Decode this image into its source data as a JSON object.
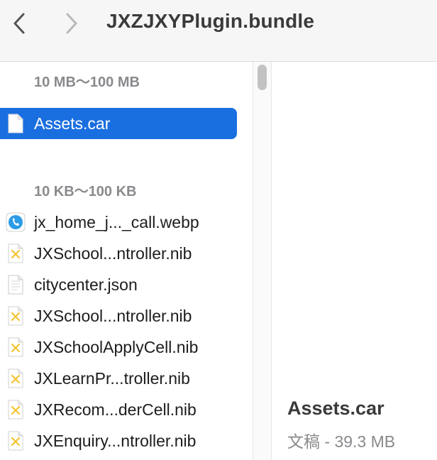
{
  "window": {
    "title": "JXZJXYPlugin.bundle"
  },
  "toolbar": {
    "back_icon": "chevron-left-icon",
    "forward_icon": "chevron-right-icon"
  },
  "colors": {
    "selection": "#1a6fe0",
    "section_header": "#8a8a8e",
    "toolbar_bg": "#f6f6f6"
  },
  "sections": [
    {
      "header": "10 MB～100 MB",
      "items": [
        {
          "name": "Assets.car",
          "icon": "document-icon",
          "selected": true
        }
      ]
    },
    {
      "header": "10 KB～100 KB",
      "items": [
        {
          "name": "jx_home_j..._call.webp",
          "icon": "webp-image-icon"
        },
        {
          "name": "JXSchool...ntroller.nib",
          "icon": "nib-file-icon"
        },
        {
          "name": "citycenter.json",
          "icon": "json-file-icon"
        },
        {
          "name": "JXSchool...ntroller.nib",
          "icon": "nib-file-icon"
        },
        {
          "name": "JXSchoolApplyCell.nib",
          "icon": "nib-file-icon"
        },
        {
          "name": "JXLearnPr...troller.nib",
          "icon": "nib-file-icon"
        },
        {
          "name": "JXRecom...derCell.nib",
          "icon": "nib-file-icon"
        },
        {
          "name": "JXEnquiry...ntroller.nib",
          "icon": "nib-file-icon"
        }
      ]
    }
  ],
  "preview": {
    "name": "Assets.car",
    "meta": "文稿 - 39.3 MB"
  }
}
